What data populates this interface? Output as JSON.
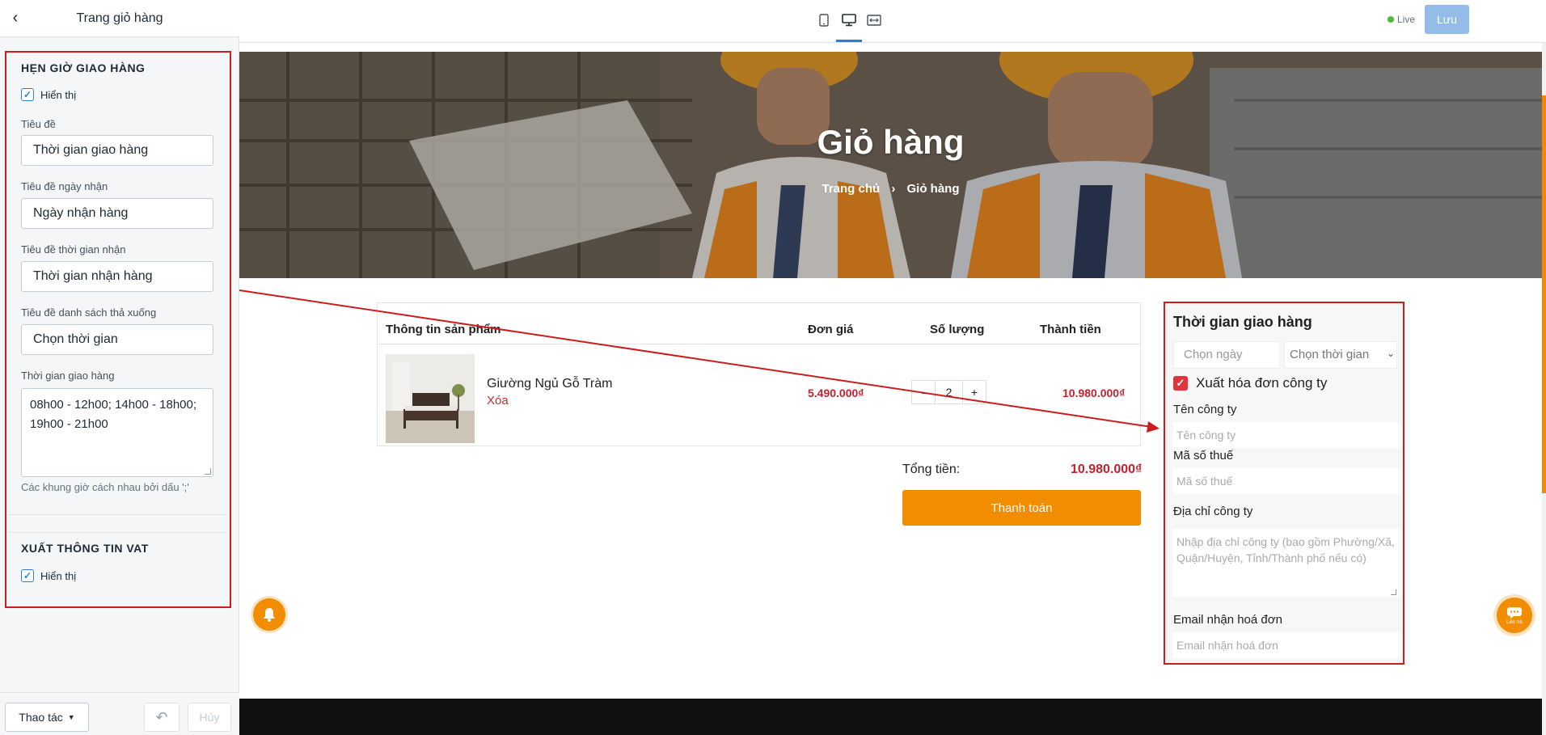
{
  "sidebar": {
    "title": "Trang giỏ hàng",
    "delivery_section": {
      "title": "HẸN GIỜ GIAO HÀNG",
      "show_label": "Hiển thị",
      "show_checked": true,
      "fields": {
        "title_label": "Tiêu đề",
        "title_value": "Thời gian giao hàng",
        "date_title_label": "Tiêu đề ngày nhận",
        "date_title_value": "Ngày nhận hàng",
        "time_title_label": "Tiêu đề thời gian nhận",
        "time_title_value": "Thời gian nhận hàng",
        "dropdown_title_label": "Tiêu đề danh sách thả xuống",
        "dropdown_title_value": "Chọn thời gian",
        "slots_label": "Thời gian giao hàng",
        "slots_value": "08h00 - 12h00; 14h00 - 18h00; 19h00 - 21h00",
        "slots_hint": "Các khung giờ cách nhau bởi dấu ';'"
      }
    },
    "vat_section": {
      "title": "XUẤT THÔNG TIN VAT",
      "show_label": "Hiển thị",
      "show_checked": true
    },
    "footer": {
      "actions_label": "Thao tác",
      "cancel_label": "Hủy"
    }
  },
  "toolbar": {
    "devices": [
      "mobile-icon",
      "desktop-icon",
      "fullwidth-icon"
    ],
    "active_device": "desktop-icon",
    "live_label": "Live",
    "save_label": "Lưu"
  },
  "preview": {
    "hero": {
      "title": "Giỏ hàng",
      "breadcrumb_home": "Trang chủ",
      "breadcrumb_sep": "›",
      "breadcrumb_current": "Giỏ hàng"
    },
    "cart": {
      "headers": {
        "product": "Thông tin sản phẩm",
        "price": "Đơn giá",
        "qty": "Số lượng",
        "total": "Thành tiền"
      },
      "items": [
        {
          "name": "Giường Ngủ Gỗ Tràm",
          "remove_label": "Xóa",
          "price": "5.490.000₫",
          "qty": "2",
          "total": "10.980.000₫"
        }
      ],
      "qty_minus": "-",
      "qty_plus": "+",
      "sum_label": "Tổng tiền:",
      "sum_value": "10.980.000₫",
      "checkout_label": "Thanh toán"
    },
    "delivery_panel": {
      "title": "Thời gian giao hàng",
      "date_placeholder": "Chọn ngày",
      "time_placeholder": "Chọn thời gian",
      "vat_label": "Xuất hóa đơn công ty",
      "vat_checked": true,
      "company_label": "Tên công ty",
      "company_placeholder": "Tên công ty",
      "tax_label": "Mã số thuế",
      "tax_placeholder": "Mã số thuế",
      "address_label": "Địa chỉ công ty",
      "address_placeholder": "Nhập địa chỉ công ty (bao gồm Phường/Xã, Quận/Huyện, Tỉnh/Thành phố nếu có)",
      "email_label": "Email nhận hoá đơn",
      "email_placeholder": "Email nhận hoá đơn"
    },
    "chat_label": "Liên hệ"
  },
  "colors": {
    "accent": "#f28c00",
    "price_red": "#c6202f",
    "annotation_red": "#cc1d1d",
    "primary_blue": "#2a7fd4",
    "save_button": "#93bde8",
    "live_green": "#50b83c"
  }
}
